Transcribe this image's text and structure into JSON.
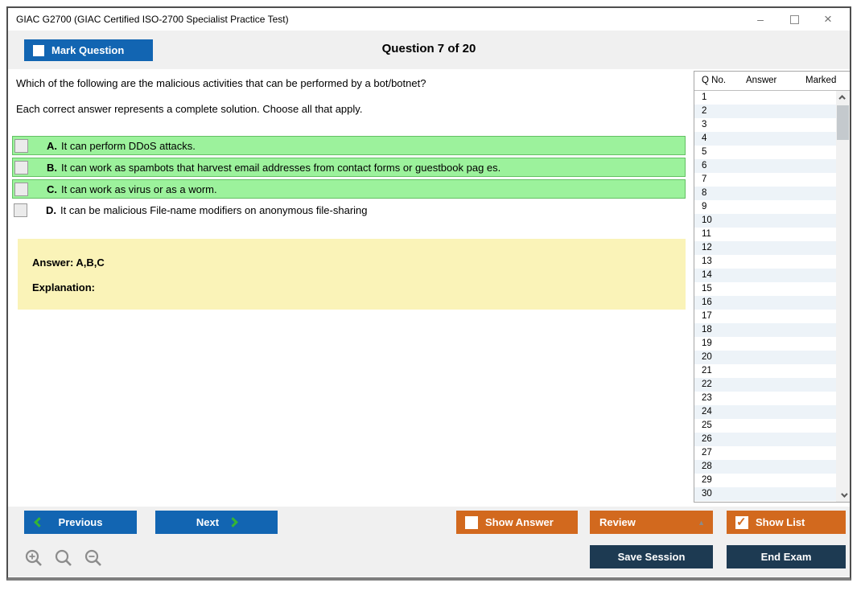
{
  "window": {
    "title": "GIAC G2700 (GIAC Certified ISO-2700 Specialist Practice Test)"
  },
  "icons": {
    "minimize": "–",
    "close": "×",
    "review_caret": "▲",
    "show_list_check": "✓"
  },
  "colors": {
    "accent_blue": "#1265B2",
    "accent_orange": "#D2691E",
    "accent_navy": "#1D3A52",
    "highlight_green": "#9CF29C",
    "answer_yellow": "#FAF3B8",
    "chevron_green": "#35B535"
  },
  "header": {
    "mark_question_label": "Mark Question",
    "question_counter": "Question 7 of 20"
  },
  "question": {
    "text": "Which of the following are the malicious activities that can be performed by a bot/botnet?",
    "instruction": "Each correct answer represents a complete solution. Choose all that apply.",
    "options": [
      {
        "letter": "A.",
        "text": "It can perform DDoS attacks.",
        "highlighted": true,
        "checked": false
      },
      {
        "letter": "B.",
        "text": "It can work as spambots that harvest email addresses from contact forms or guestbook pag es.",
        "highlighted": true,
        "checked": false
      },
      {
        "letter": "C.",
        "text": "It can work as virus or as a worm.",
        "highlighted": true,
        "checked": false
      },
      {
        "letter": "D.",
        "text": "It can be malicious File-name modifiers on anonymous file-sharing",
        "highlighted": false,
        "checked": false
      }
    ],
    "answer_label": "Answer: A,B,C",
    "explanation_label": "Explanation:"
  },
  "question_list": {
    "columns": [
      "Q No.",
      "Answer",
      "Marked"
    ],
    "rows": [
      {
        "q": "1",
        "answer": "",
        "marked": ""
      },
      {
        "q": "2",
        "answer": "",
        "marked": ""
      },
      {
        "q": "3",
        "answer": "",
        "marked": ""
      },
      {
        "q": "4",
        "answer": "",
        "marked": ""
      },
      {
        "q": "5",
        "answer": "",
        "marked": ""
      },
      {
        "q": "6",
        "answer": "",
        "marked": ""
      },
      {
        "q": "7",
        "answer": "",
        "marked": ""
      },
      {
        "q": "8",
        "answer": "",
        "marked": ""
      },
      {
        "q": "9",
        "answer": "",
        "marked": ""
      },
      {
        "q": "10",
        "answer": "",
        "marked": ""
      },
      {
        "q": "11",
        "answer": "",
        "marked": ""
      },
      {
        "q": "12",
        "answer": "",
        "marked": ""
      },
      {
        "q": "13",
        "answer": "",
        "marked": ""
      },
      {
        "q": "14",
        "answer": "",
        "marked": ""
      },
      {
        "q": "15",
        "answer": "",
        "marked": ""
      },
      {
        "q": "16",
        "answer": "",
        "marked": ""
      },
      {
        "q": "17",
        "answer": "",
        "marked": ""
      },
      {
        "q": "18",
        "answer": "",
        "marked": ""
      },
      {
        "q": "19",
        "answer": "",
        "marked": ""
      },
      {
        "q": "20",
        "answer": "",
        "marked": ""
      },
      {
        "q": "21",
        "answer": "",
        "marked": ""
      },
      {
        "q": "22",
        "answer": "",
        "marked": ""
      },
      {
        "q": "23",
        "answer": "",
        "marked": ""
      },
      {
        "q": "24",
        "answer": "",
        "marked": ""
      },
      {
        "q": "25",
        "answer": "",
        "marked": ""
      },
      {
        "q": "26",
        "answer": "",
        "marked": ""
      },
      {
        "q": "27",
        "answer": "",
        "marked": ""
      },
      {
        "q": "28",
        "answer": "",
        "marked": ""
      },
      {
        "q": "29",
        "answer": "",
        "marked": ""
      },
      {
        "q": "30",
        "answer": "",
        "marked": ""
      }
    ]
  },
  "footer": {
    "previous_label": "Previous",
    "next_label": "Next",
    "show_answer_label": "Show Answer",
    "review_label": "Review",
    "show_list_label": "Show List",
    "save_session_label": "Save Session",
    "end_exam_label": "End Exam"
  }
}
